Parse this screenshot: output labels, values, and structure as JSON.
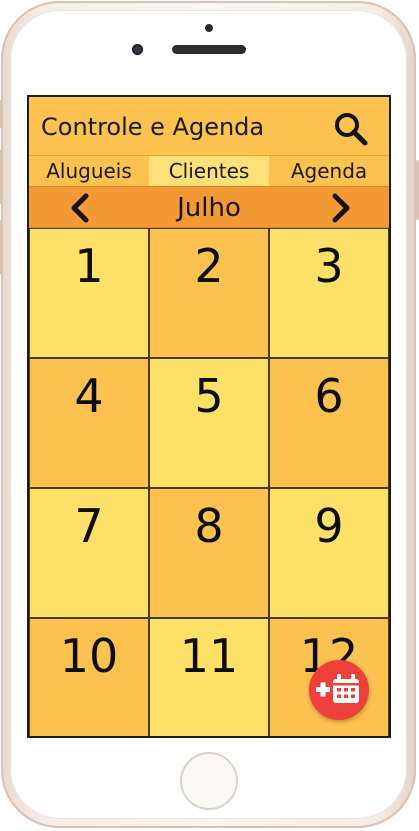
{
  "app": {
    "title": "Controle e Agenda",
    "search_icon": "search-icon"
  },
  "tabs": [
    {
      "label": "Alugueis",
      "active": false
    },
    {
      "label": "Clientes",
      "active": true
    },
    {
      "label": "Agenda",
      "active": false
    }
  ],
  "calendar": {
    "month": "Julho",
    "prev_icon": "chevron-left-icon",
    "next_icon": "chevron-right-icon",
    "days": [
      "1",
      "2",
      "3",
      "4",
      "5",
      "6",
      "7",
      "8",
      "9",
      "10",
      "11",
      "12"
    ]
  },
  "fab": {
    "icon": "add-calendar-event-icon",
    "color": "#ee3f3b"
  },
  "colors": {
    "header": "#fbc24f",
    "month_bar": "#f39a34",
    "cell_light": "#fde068",
    "cell_dark": "#fbc24f"
  }
}
